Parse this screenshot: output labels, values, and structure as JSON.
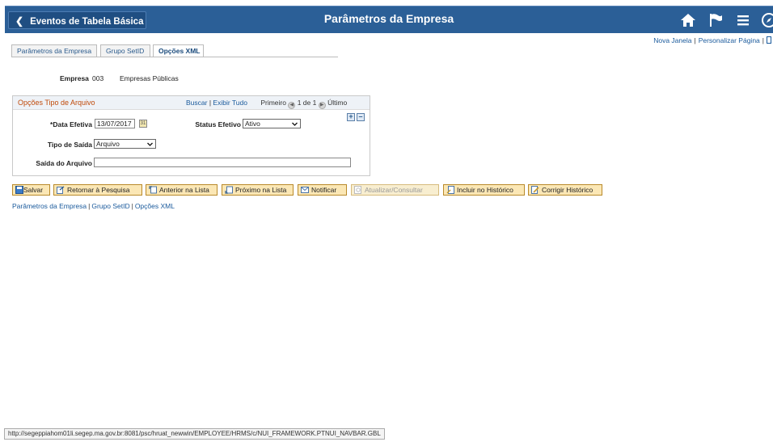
{
  "header": {
    "back_label": "Eventos de Tabela Básica",
    "title": "Parâmetros da Empresa",
    "icons": [
      "home-icon",
      "flag-icon",
      "menu-icon",
      "navbar-compass-icon"
    ]
  },
  "top_links": {
    "new_window": "Nova Janela",
    "personalize": "Personalizar Página"
  },
  "tabs": [
    {
      "label": "Parâmetros da Empresa",
      "active": false
    },
    {
      "label": "Grupo SetID",
      "active": false
    },
    {
      "label": "Opções XML",
      "active": true
    }
  ],
  "empresa": {
    "label": "Empresa",
    "code": "003",
    "description": "Empresas Públicas"
  },
  "panel": {
    "title": "Opções Tipo de Arquivo",
    "search": "Buscar",
    "view_all": "Exibir Tudo",
    "first": "Primeiro",
    "range": "1 de 1",
    "last": "Último",
    "effdate_label": "*Data Efetiva",
    "effdate_value": "13/07/2017",
    "status_label": "Status Efetivo",
    "status_value": "Ativo",
    "output_type_label": "Tipo de Saída",
    "output_type_value": "Arquivo",
    "output_file_label": "Saída do Arquivo",
    "output_file_value": ""
  },
  "toolbar": {
    "save": "Salvar",
    "return_search": "Retornar à Pesquisa",
    "prev_list": "Anterior na Lista",
    "next_list": "Próximo na Lista",
    "notify": "Notificar",
    "update_display": "Atualizar/Consultar",
    "include_history": "Incluir no Histórico",
    "correct_history": "Corrigir Histórico"
  },
  "bottom_links": [
    "Parâmetros da Empresa",
    "Grupo SetID",
    "Opções XML"
  ],
  "status_bar": "http://segeppiahom01li.segep.ma.gov.br:8081/psc/hruat_newwin/EMPLOYEE/HRMS/c/NUI_FRAMEWORK.PTNUI_NAVBAR.GBL",
  "colors": {
    "header_bg": "#2b5f97",
    "panel_title": "#c04a0a",
    "link": "#1a5a9c",
    "button_bg": "#fbe7b5"
  }
}
